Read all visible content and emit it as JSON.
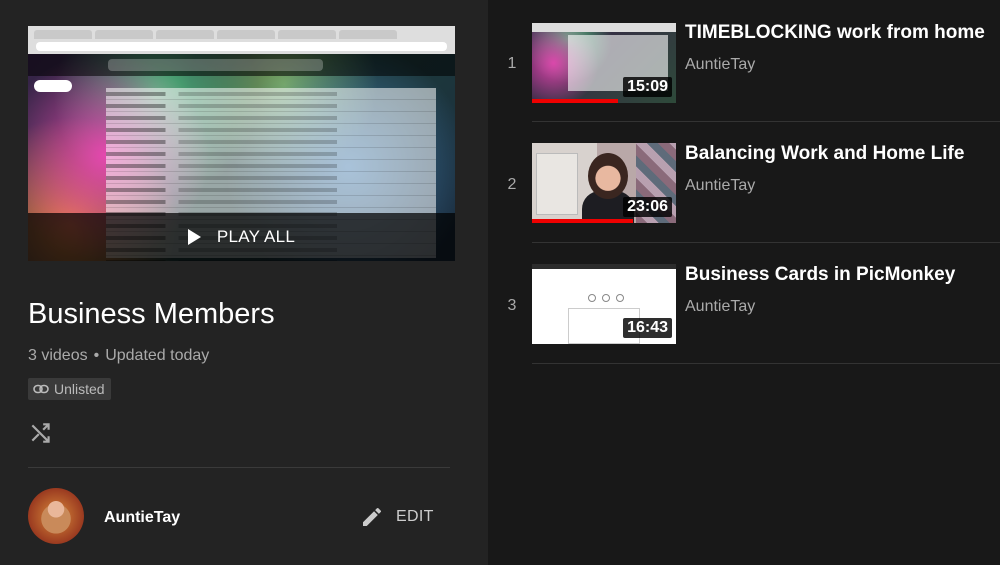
{
  "playlist": {
    "play_all_label": "PLAY ALL",
    "title": "Business Members",
    "video_count": "3 videos",
    "stats_separator": "•",
    "updated": "Updated today",
    "privacy": "Unlisted"
  },
  "owner": {
    "name": "AuntieTay",
    "edit_label": "EDIT"
  },
  "videos": [
    {
      "index": "1",
      "title": "TIMEBLOCKING work from home",
      "channel": "AuntieTay",
      "duration": "15:09",
      "progress": 0.6
    },
    {
      "index": "2",
      "title": "Balancing Work and Home Life",
      "channel": "AuntieTay",
      "duration": "23:06",
      "progress": 0.7
    },
    {
      "index": "3",
      "title": "Business Cards in PicMonkey",
      "channel": "AuntieTay",
      "duration": "16:43",
      "progress": 0
    }
  ],
  "colors": {
    "background": "#181818",
    "panel": "#232323",
    "progress": "#ee0000",
    "secondary_text": "#aaaaaa"
  },
  "icons": {
    "play": "play-icon",
    "link": "link-icon",
    "shuffle": "shuffle-icon",
    "edit": "pencil-icon"
  }
}
